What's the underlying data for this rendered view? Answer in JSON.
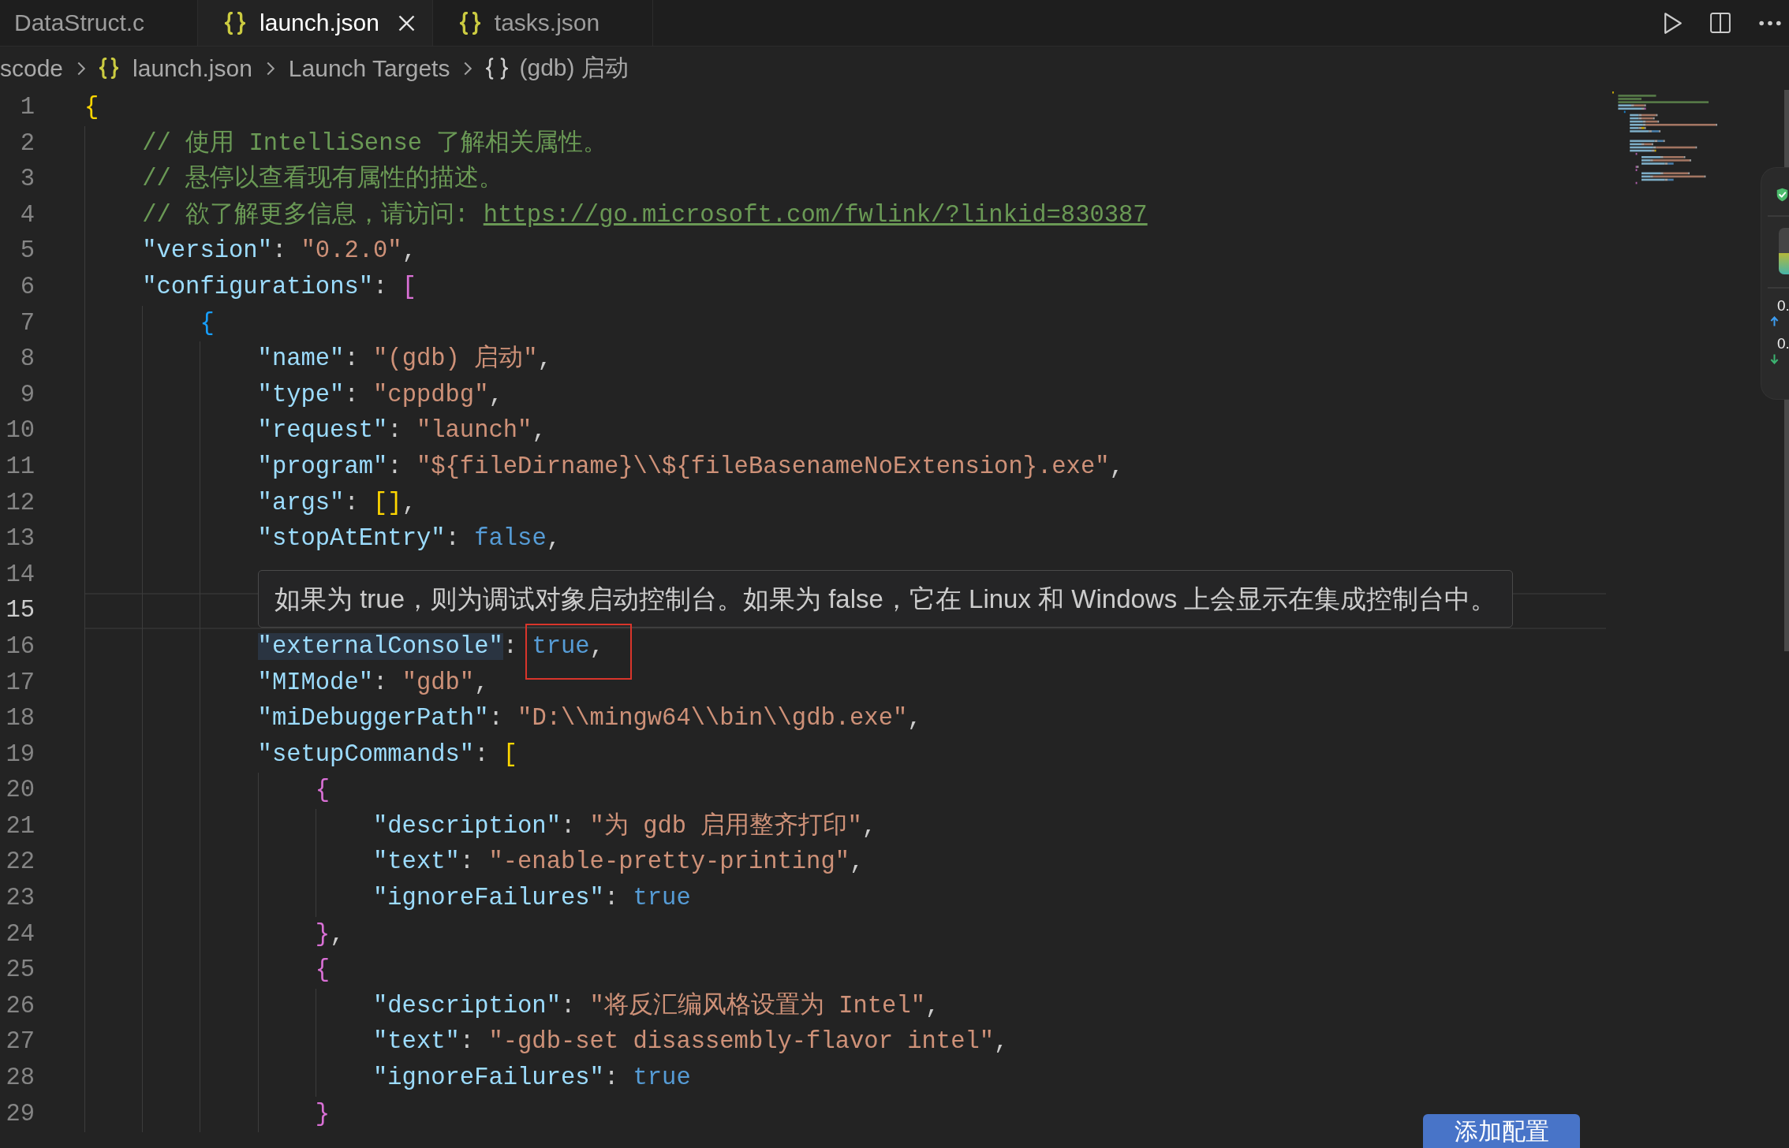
{
  "tabs": [
    {
      "label": "DataStruct.c",
      "kind": "c",
      "selected": false
    },
    {
      "label": "launch.json",
      "kind": "json",
      "selected": true
    },
    {
      "label": "tasks.json",
      "kind": "json",
      "selected": false
    }
  ],
  "breadcrumbs": [
    {
      "label": "scode",
      "kind": "folder"
    },
    {
      "label": "launch.json",
      "kind": "file"
    },
    {
      "label": "Launch Targets",
      "kind": "section"
    },
    {
      "label": "(gdb) 启动",
      "kind": "object"
    }
  ],
  "editor": {
    "lines": [
      {
        "number": "1",
        "current": false,
        "segments": [
          {
            "kind": "bracket",
            "text": "{",
            "color": "#ffd700"
          }
        ],
        "children": [
          {
            "number": "2",
            "current": false,
            "segments": [
              {
                "kind": "comment",
                "text": "// 使用 IntelliSense 了解相关属性。"
              }
            ]
          },
          {
            "number": "3",
            "current": false,
            "segments": [
              {
                "kind": "comment",
                "text": "// 悬停以查看现有属性的描述。"
              }
            ]
          },
          {
            "number": "4",
            "current": false,
            "segments": [
              {
                "kind": "comment",
                "text": "// 欲了解更多信息，请访问: "
              },
              {
                "kind": "link",
                "text": "https://go.microsoft.com/fwlink/?linkid=830387"
              }
            ]
          },
          {
            "number": "5",
            "current": false,
            "segments": [
              {
                "kind": "key",
                "text": "\"version\""
              },
              {
                "kind": "punct",
                "text": ": "
              },
              {
                "kind": "string",
                "text": "\"0.2.0\""
              },
              {
                "kind": "punct",
                "text": ","
              }
            ]
          },
          {
            "number": "6",
            "current": false,
            "segments": [
              {
                "kind": "key",
                "text": "\"configurations\""
              },
              {
                "kind": "punct",
                "text": ": "
              },
              {
                "kind": "bracket",
                "text": "[",
                "color": "#da70d6"
              }
            ],
            "children": [
              {
                "number": "7",
                "current": false,
                "segments": [
                  {
                    "kind": "bracket",
                    "text": "{",
                    "color": "#179fff"
                  }
                ],
                "children": [
                  {
                    "number": "8",
                    "current": false,
                    "segments": [
                      {
                        "kind": "key",
                        "text": "\"name\""
                      },
                      {
                        "kind": "punct",
                        "text": ": "
                      },
                      {
                        "kind": "string",
                        "text": "\"(gdb) 启动\""
                      },
                      {
                        "kind": "punct",
                        "text": ","
                      }
                    ]
                  },
                  {
                    "number": "9",
                    "current": false,
                    "segments": [
                      {
                        "kind": "key",
                        "text": "\"type\""
                      },
                      {
                        "kind": "punct",
                        "text": ": "
                      },
                      {
                        "kind": "string",
                        "text": "\"cppdbg\""
                      },
                      {
                        "kind": "punct",
                        "text": ","
                      }
                    ]
                  },
                  {
                    "number": "10",
                    "current": false,
                    "segments": [
                      {
                        "kind": "key",
                        "text": "\"request\""
                      },
                      {
                        "kind": "punct",
                        "text": ": "
                      },
                      {
                        "kind": "string",
                        "text": "\"launch\""
                      },
                      {
                        "kind": "punct",
                        "text": ","
                      }
                    ]
                  },
                  {
                    "number": "11",
                    "current": false,
                    "segments": [
                      {
                        "kind": "key",
                        "text": "\"program\""
                      },
                      {
                        "kind": "punct",
                        "text": ": "
                      },
                      {
                        "kind": "string",
                        "text": "\"${fileDirname}\\\\${fileBasenameNoExtension}.exe\""
                      },
                      {
                        "kind": "punct",
                        "text": ","
                      }
                    ]
                  },
                  {
                    "number": "12",
                    "current": false,
                    "segments": [
                      {
                        "kind": "key",
                        "text": "\"args\""
                      },
                      {
                        "kind": "punct",
                        "text": ": "
                      },
                      {
                        "kind": "bracket",
                        "text": "[]",
                        "color": "#ffd700"
                      },
                      {
                        "kind": "punct",
                        "text": ","
                      }
                    ]
                  },
                  {
                    "number": "13",
                    "current": false,
                    "segments": [
                      {
                        "kind": "key",
                        "text": "\"stopAtEntry\""
                      },
                      {
                        "kind": "punct",
                        "text": ": "
                      },
                      {
                        "kind": "literal",
                        "text": "false"
                      },
                      {
                        "kind": "punct",
                        "text": ","
                      }
                    ]
                  },
                  {
                    "number": "14",
                    "current": false
                  },
                  {
                    "number": "15",
                    "current": true
                  },
                  {
                    "number": "16",
                    "current": false,
                    "segments": [
                      {
                        "kind": "hovered",
                        "text": "\"externalConsole\""
                      },
                      {
                        "kind": "punct",
                        "text": ": "
                      },
                      {
                        "kind": "marked",
                        "text": "true"
                      },
                      {
                        "kind": "punct",
                        "text": ","
                      }
                    ]
                  },
                  {
                    "number": "17",
                    "current": false,
                    "segments": [
                      {
                        "kind": "key",
                        "text": "\"MIMode\""
                      },
                      {
                        "kind": "punct",
                        "text": ": "
                      },
                      {
                        "kind": "string",
                        "text": "\"gdb\""
                      },
                      {
                        "kind": "punct",
                        "text": ","
                      }
                    ]
                  },
                  {
                    "number": "18",
                    "current": false,
                    "segments": [
                      {
                        "kind": "key",
                        "text": "\"miDebuggerPath\""
                      },
                      {
                        "kind": "punct",
                        "text": ": "
                      },
                      {
                        "kind": "string",
                        "text": "\"D:\\\\mingw64\\\\bin\\\\gdb.exe\""
                      },
                      {
                        "kind": "punct",
                        "text": ","
                      }
                    ]
                  },
                  {
                    "number": "19",
                    "current": false,
                    "segments": [
                      {
                        "kind": "key",
                        "text": "\"setupCommands\""
                      },
                      {
                        "kind": "punct",
                        "text": ": "
                      },
                      {
                        "kind": "bracket",
                        "text": "[",
                        "color": "#ffd700"
                      }
                    ],
                    "children": [
                      {
                        "number": "20",
                        "current": false,
                        "segments": [
                          {
                            "kind": "bracket",
                            "text": "{",
                            "color": "#da70d6"
                          }
                        ],
                        "children": [
                          {
                            "number": "21",
                            "current": false,
                            "segments": [
                              {
                                "kind": "key",
                                "text": "\"description\""
                              },
                              {
                                "kind": "punct",
                                "text": ": "
                              },
                              {
                                "kind": "string",
                                "text": "\"为 gdb 启用整齐打印\""
                              },
                              {
                                "kind": "punct",
                                "text": ","
                              }
                            ]
                          },
                          {
                            "number": "22",
                            "current": false,
                            "segments": [
                              {
                                "kind": "key",
                                "text": "\"text\""
                              },
                              {
                                "kind": "punct",
                                "text": ": "
                              },
                              {
                                "kind": "string",
                                "text": "\"-enable-pretty-printing\""
                              },
                              {
                                "kind": "punct",
                                "text": ","
                              }
                            ]
                          },
                          {
                            "number": "23",
                            "current": false,
                            "segments": [
                              {
                                "kind": "key",
                                "text": "\"ignoreFailures\""
                              },
                              {
                                "kind": "punct",
                                "text": ": "
                              },
                              {
                                "kind": "literal",
                                "text": "true"
                              }
                            ]
                          }
                        ]
                      },
                      {
                        "number": "24",
                        "current": false,
                        "segments": [
                          {
                            "kind": "bracket",
                            "text": "}",
                            "color": "#da70d6"
                          },
                          {
                            "kind": "punct",
                            "text": ","
                          }
                        ]
                      },
                      {
                        "number": "25",
                        "current": false,
                        "segments": [
                          {
                            "kind": "bracket",
                            "text": "{",
                            "color": "#da70d6"
                          }
                        ],
                        "children": [
                          {
                            "number": "26",
                            "current": false,
                            "segments": [
                              {
                                "kind": "key",
                                "text": "\"description\""
                              },
                              {
                                "kind": "punct",
                                "text": ": "
                              },
                              {
                                "kind": "string",
                                "text": "\"将反汇编风格设置为 Intel\""
                              },
                              {
                                "kind": "punct",
                                "text": ","
                              }
                            ]
                          },
                          {
                            "number": "27",
                            "current": false,
                            "segments": [
                              {
                                "kind": "key",
                                "text": "\"text\""
                              },
                              {
                                "kind": "punct",
                                "text": ": "
                              },
                              {
                                "kind": "string",
                                "text": "\"-gdb-set disassembly-flavor intel\""
                              },
                              {
                                "kind": "punct",
                                "text": ","
                              }
                            ]
                          },
                          {
                            "number": "28",
                            "current": false,
                            "segments": [
                              {
                                "kind": "key",
                                "text": "\"ignoreFailures\""
                              },
                              {
                                "kind": "punct",
                                "text": ": "
                              },
                              {
                                "kind": "literal",
                                "text": "true"
                              }
                            ]
                          }
                        ]
                      },
                      {
                        "number": "29",
                        "current": false,
                        "segments": [
                          {
                            "kind": "bracket",
                            "text": "}",
                            "color": "#da70d6"
                          }
                        ]
                      }
                    ]
                  }
                ]
              }
            ]
          }
        ]
      }
    ]
  },
  "hover_tooltip": {
    "text": "如果为 true，则为调试对象启动控制台。如果为 false，它在 Linux 和 Windows 上会显示在集成控制台中。"
  },
  "add_configuration_button": {
    "label": "添加配置"
  },
  "monitor_widget": {
    "gauge": {
      "level": 0.46
    },
    "readings": [
      {
        "kind": "up",
        "text": "0."
      },
      {
        "kind": "down",
        "text": "0."
      }
    ]
  }
}
